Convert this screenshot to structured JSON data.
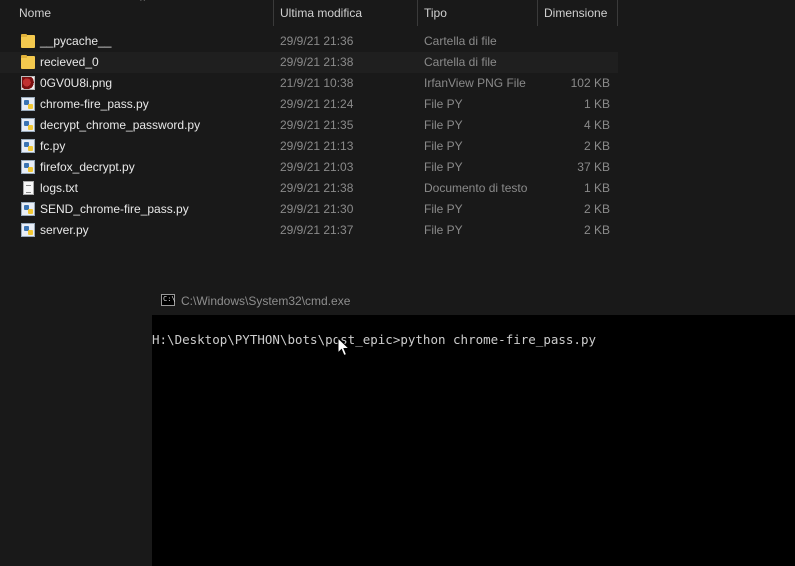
{
  "explorer": {
    "columns": {
      "name": "Nome",
      "modified": "Ultima modifica",
      "type": "Tipo",
      "size": "Dimensione"
    },
    "files": [
      {
        "name": "__pycache__",
        "date": "29/9/21 21:36",
        "type": "Cartella di file",
        "size": "",
        "icon": "folder-icon"
      },
      {
        "name": "recieved_0",
        "date": "29/9/21 21:38",
        "type": "Cartella di file",
        "size": "",
        "icon": "folder-icon"
      },
      {
        "name": "0GV0U8i.png",
        "date": "21/9/21 10:38",
        "type": "IrfanView PNG File",
        "size": "102 KB",
        "icon": "png-image-icon"
      },
      {
        "name": "chrome-fire_pass.py",
        "date": "29/9/21 21:24",
        "type": "File PY",
        "size": "1 KB",
        "icon": "python-file-icon"
      },
      {
        "name": "decrypt_chrome_password.py",
        "date": "29/9/21 21:35",
        "type": "File PY",
        "size": "4 KB",
        "icon": "python-file-icon"
      },
      {
        "name": "fc.py",
        "date": "29/9/21 21:13",
        "type": "File PY",
        "size": "2 KB",
        "icon": "python-file-icon"
      },
      {
        "name": "firefox_decrypt.py",
        "date": "29/9/21 21:03",
        "type": "File PY",
        "size": "37 KB",
        "icon": "python-file-icon"
      },
      {
        "name": "logs.txt",
        "date": "29/9/21 21:38",
        "type": "Documento di testo",
        "size": "1 KB",
        "icon": "text-file-icon"
      },
      {
        "name": "SEND_chrome-fire_pass.py",
        "date": "29/9/21 21:30",
        "type": "File PY",
        "size": "2 KB",
        "icon": "python-file-icon"
      },
      {
        "name": "server.py",
        "date": "29/9/21 21:37",
        "type": "File PY",
        "size": "2 KB",
        "icon": "python-file-icon"
      }
    ]
  },
  "cmd": {
    "title": "C:\\Windows\\System32\\cmd.exe",
    "icon_text": "C:\\",
    "prompt_line": "H:\\Desktop\\PYTHON\\bots\\post_epic>python chrome-fire_pass.py"
  }
}
